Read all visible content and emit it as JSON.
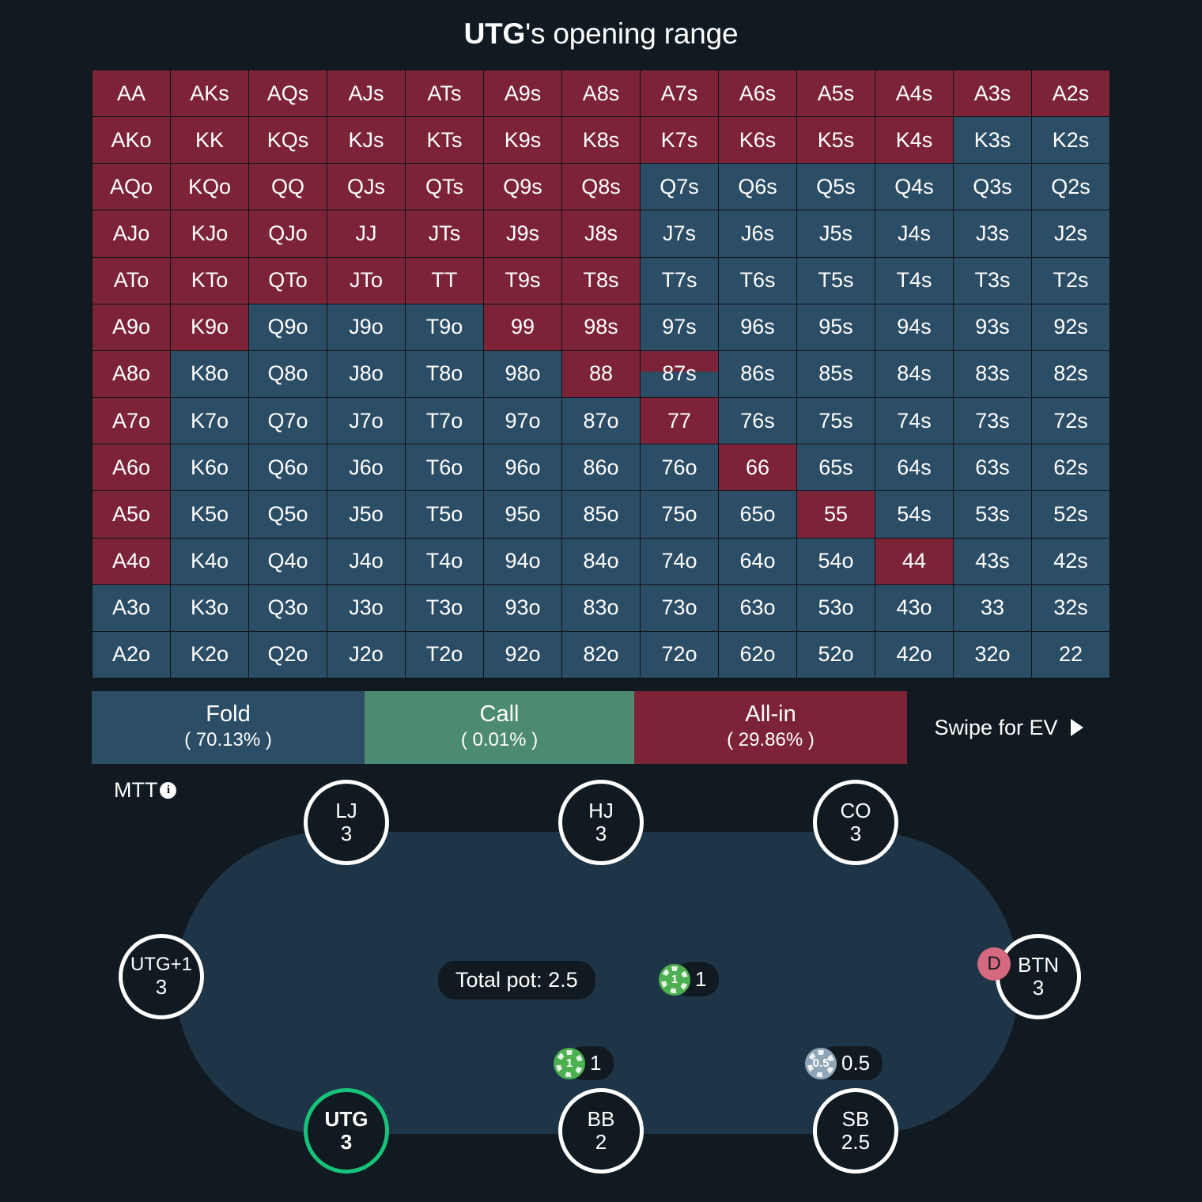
{
  "title": {
    "hero": "UTG",
    "rest": "'s opening range"
  },
  "grid": {
    "rows": [
      [
        {
          "t": "AA",
          "f": 100
        },
        {
          "t": "AKs",
          "f": 100
        },
        {
          "t": "AQs",
          "f": 100
        },
        {
          "t": "AJs",
          "f": 100
        },
        {
          "t": "ATs",
          "f": 100
        },
        {
          "t": "A9s",
          "f": 100
        },
        {
          "t": "A8s",
          "f": 100
        },
        {
          "t": "A7s",
          "f": 100
        },
        {
          "t": "A6s",
          "f": 100
        },
        {
          "t": "A5s",
          "f": 100
        },
        {
          "t": "A4s",
          "f": 100
        },
        {
          "t": "A3s",
          "f": 100
        },
        {
          "t": "A2s",
          "f": 100
        }
      ],
      [
        {
          "t": "AKo",
          "f": 100
        },
        {
          "t": "KK",
          "f": 100
        },
        {
          "t": "KQs",
          "f": 100
        },
        {
          "t": "KJs",
          "f": 100
        },
        {
          "t": "KTs",
          "f": 100
        },
        {
          "t": "K9s",
          "f": 100
        },
        {
          "t": "K8s",
          "f": 100
        },
        {
          "t": "K7s",
          "f": 100
        },
        {
          "t": "K6s",
          "f": 100
        },
        {
          "t": "K5s",
          "f": 100
        },
        {
          "t": "K4s",
          "f": 100
        },
        {
          "t": "K3s",
          "f": 0
        },
        {
          "t": "K2s",
          "f": 0
        }
      ],
      [
        {
          "t": "AQo",
          "f": 100
        },
        {
          "t": "KQo",
          "f": 100
        },
        {
          "t": "QQ",
          "f": 100
        },
        {
          "t": "QJs",
          "f": 100
        },
        {
          "t": "QTs",
          "f": 100
        },
        {
          "t": "Q9s",
          "f": 100
        },
        {
          "t": "Q8s",
          "f": 100
        },
        {
          "t": "Q7s",
          "f": 0
        },
        {
          "t": "Q6s",
          "f": 0
        },
        {
          "t": "Q5s",
          "f": 0
        },
        {
          "t": "Q4s",
          "f": 0
        },
        {
          "t": "Q3s",
          "f": 0
        },
        {
          "t": "Q2s",
          "f": 0
        }
      ],
      [
        {
          "t": "AJo",
          "f": 100
        },
        {
          "t": "KJo",
          "f": 100
        },
        {
          "t": "QJo",
          "f": 100
        },
        {
          "t": "JJ",
          "f": 100
        },
        {
          "t": "JTs",
          "f": 100
        },
        {
          "t": "J9s",
          "f": 100
        },
        {
          "t": "J8s",
          "f": 100
        },
        {
          "t": "J7s",
          "f": 0
        },
        {
          "t": "J6s",
          "f": 0
        },
        {
          "t": "J5s",
          "f": 0
        },
        {
          "t": "J4s",
          "f": 0
        },
        {
          "t": "J3s",
          "f": 0
        },
        {
          "t": "J2s",
          "f": 0
        }
      ],
      [
        {
          "t": "ATo",
          "f": 100
        },
        {
          "t": "KTo",
          "f": 100
        },
        {
          "t": "QTo",
          "f": 100
        },
        {
          "t": "JTo",
          "f": 100
        },
        {
          "t": "TT",
          "f": 100
        },
        {
          "t": "T9s",
          "f": 100
        },
        {
          "t": "T8s",
          "f": 100
        },
        {
          "t": "T7s",
          "f": 0
        },
        {
          "t": "T6s",
          "f": 0
        },
        {
          "t": "T5s",
          "f": 0
        },
        {
          "t": "T4s",
          "f": 0
        },
        {
          "t": "T3s",
          "f": 0
        },
        {
          "t": "T2s",
          "f": 0
        }
      ],
      [
        {
          "t": "A9o",
          "f": 100
        },
        {
          "t": "K9o",
          "f": 100
        },
        {
          "t": "Q9o",
          "f": 0
        },
        {
          "t": "J9o",
          "f": 0
        },
        {
          "t": "T9o",
          "f": 0
        },
        {
          "t": "99",
          "f": 100
        },
        {
          "t": "98s",
          "f": 100
        },
        {
          "t": "97s",
          "f": 0
        },
        {
          "t": "96s",
          "f": 0
        },
        {
          "t": "95s",
          "f": 0
        },
        {
          "t": "94s",
          "f": 0
        },
        {
          "t": "93s",
          "f": 0
        },
        {
          "t": "92s",
          "f": 0
        }
      ],
      [
        {
          "t": "A8o",
          "f": 100
        },
        {
          "t": "K8o",
          "f": 0
        },
        {
          "t": "Q8o",
          "f": 0
        },
        {
          "t": "J8o",
          "f": 0
        },
        {
          "t": "T8o",
          "f": 0
        },
        {
          "t": "98o",
          "f": 0
        },
        {
          "t": "88",
          "f": 100
        },
        {
          "t": "87s",
          "f": 45
        },
        {
          "t": "86s",
          "f": 0
        },
        {
          "t": "85s",
          "f": 0
        },
        {
          "t": "84s",
          "f": 0
        },
        {
          "t": "83s",
          "f": 0
        },
        {
          "t": "82s",
          "f": 0
        }
      ],
      [
        {
          "t": "A7o",
          "f": 100
        },
        {
          "t": "K7o",
          "f": 0
        },
        {
          "t": "Q7o",
          "f": 0
        },
        {
          "t": "J7o",
          "f": 0
        },
        {
          "t": "T7o",
          "f": 0
        },
        {
          "t": "97o",
          "f": 0
        },
        {
          "t": "87o",
          "f": 0
        },
        {
          "t": "77",
          "f": 100
        },
        {
          "t": "76s",
          "f": 0
        },
        {
          "t": "75s",
          "f": 0
        },
        {
          "t": "74s",
          "f": 0
        },
        {
          "t": "73s",
          "f": 0
        },
        {
          "t": "72s",
          "f": 0
        }
      ],
      [
        {
          "t": "A6o",
          "f": 100
        },
        {
          "t": "K6o",
          "f": 0
        },
        {
          "t": "Q6o",
          "f": 0
        },
        {
          "t": "J6o",
          "f": 0
        },
        {
          "t": "T6o",
          "f": 0
        },
        {
          "t": "96o",
          "f": 0
        },
        {
          "t": "86o",
          "f": 0
        },
        {
          "t": "76o",
          "f": 0
        },
        {
          "t": "66",
          "f": 100
        },
        {
          "t": "65s",
          "f": 0
        },
        {
          "t": "64s",
          "f": 0
        },
        {
          "t": "63s",
          "f": 0
        },
        {
          "t": "62s",
          "f": 0
        }
      ],
      [
        {
          "t": "A5o",
          "f": 100
        },
        {
          "t": "K5o",
          "f": 0
        },
        {
          "t": "Q5o",
          "f": 0
        },
        {
          "t": "J5o",
          "f": 0
        },
        {
          "t": "T5o",
          "f": 0
        },
        {
          "t": "95o",
          "f": 0
        },
        {
          "t": "85o",
          "f": 0
        },
        {
          "t": "75o",
          "f": 0
        },
        {
          "t": "65o",
          "f": 0
        },
        {
          "t": "55",
          "f": 100
        },
        {
          "t": "54s",
          "f": 0
        },
        {
          "t": "53s",
          "f": 0
        },
        {
          "t": "52s",
          "f": 0
        }
      ],
      [
        {
          "t": "A4o",
          "f": 100
        },
        {
          "t": "K4o",
          "f": 0
        },
        {
          "t": "Q4o",
          "f": 0
        },
        {
          "t": "J4o",
          "f": 0
        },
        {
          "t": "T4o",
          "f": 0
        },
        {
          "t": "94o",
          "f": 0
        },
        {
          "t": "84o",
          "f": 0
        },
        {
          "t": "74o",
          "f": 0
        },
        {
          "t": "64o",
          "f": 0
        },
        {
          "t": "54o",
          "f": 0
        },
        {
          "t": "44",
          "f": 100
        },
        {
          "t": "43s",
          "f": 0
        },
        {
          "t": "42s",
          "f": 0
        }
      ],
      [
        {
          "t": "A3o",
          "f": 0
        },
        {
          "t": "K3o",
          "f": 0
        },
        {
          "t": "Q3o",
          "f": 0
        },
        {
          "t": "J3o",
          "f": 0
        },
        {
          "t": "T3o",
          "f": 0
        },
        {
          "t": "93o",
          "f": 0
        },
        {
          "t": "83o",
          "f": 0
        },
        {
          "t": "73o",
          "f": 0
        },
        {
          "t": "63o",
          "f": 0
        },
        {
          "t": "53o",
          "f": 0
        },
        {
          "t": "43o",
          "f": 0
        },
        {
          "t": "33",
          "f": 0
        },
        {
          "t": "32s",
          "f": 0
        }
      ],
      [
        {
          "t": "A2o",
          "f": 0
        },
        {
          "t": "K2o",
          "f": 0
        },
        {
          "t": "Q2o",
          "f": 0
        },
        {
          "t": "J2o",
          "f": 0
        },
        {
          "t": "T2o",
          "f": 0
        },
        {
          "t": "92o",
          "f": 0
        },
        {
          "t": "82o",
          "f": 0
        },
        {
          "t": "72o",
          "f": 0
        },
        {
          "t": "62o",
          "f": 0
        },
        {
          "t": "52o",
          "f": 0
        },
        {
          "t": "42o",
          "f": 0
        },
        {
          "t": "32o",
          "f": 0
        },
        {
          "t": "22",
          "f": 0
        }
      ]
    ],
    "colors": {
      "fold": "#2c4d66",
      "allin": "#7d2338"
    }
  },
  "actions": [
    {
      "name": "Fold",
      "pct": "( 70.13% )",
      "color": "#2c4d66"
    },
    {
      "name": "Call",
      "pct": "( 0.01% )",
      "color": "#4d8a72"
    },
    {
      "name": "All-in",
      "pct": "( 29.86% )",
      "color": "#7d2338"
    }
  ],
  "swipe_label": "Swipe for EV",
  "game_type": {
    "label": "MTT",
    "info": "i"
  },
  "table": {
    "pot_label": "Total pot: 2.5",
    "dealer_mark": "D",
    "seats": [
      {
        "pos": "LJ",
        "stack": "3",
        "hero": false
      },
      {
        "pos": "HJ",
        "stack": "3",
        "hero": false
      },
      {
        "pos": "CO",
        "stack": "3",
        "hero": false
      },
      {
        "pos": "UTG+1",
        "stack": "3",
        "hero": false
      },
      {
        "pos": "BTN",
        "stack": "3",
        "hero": false
      },
      {
        "pos": "UTG",
        "stack": "3",
        "hero": true
      },
      {
        "pos": "BB",
        "stack": "2",
        "hero": false
      },
      {
        "pos": "SB",
        "stack": "2.5",
        "hero": false
      }
    ],
    "bets": [
      {
        "chip": "1",
        "amount": "1",
        "color": "green"
      },
      {
        "chip": "1",
        "amount": "1",
        "color": "green"
      },
      {
        "chip": "0.5",
        "amount": "0.5",
        "color": "blue"
      }
    ]
  }
}
